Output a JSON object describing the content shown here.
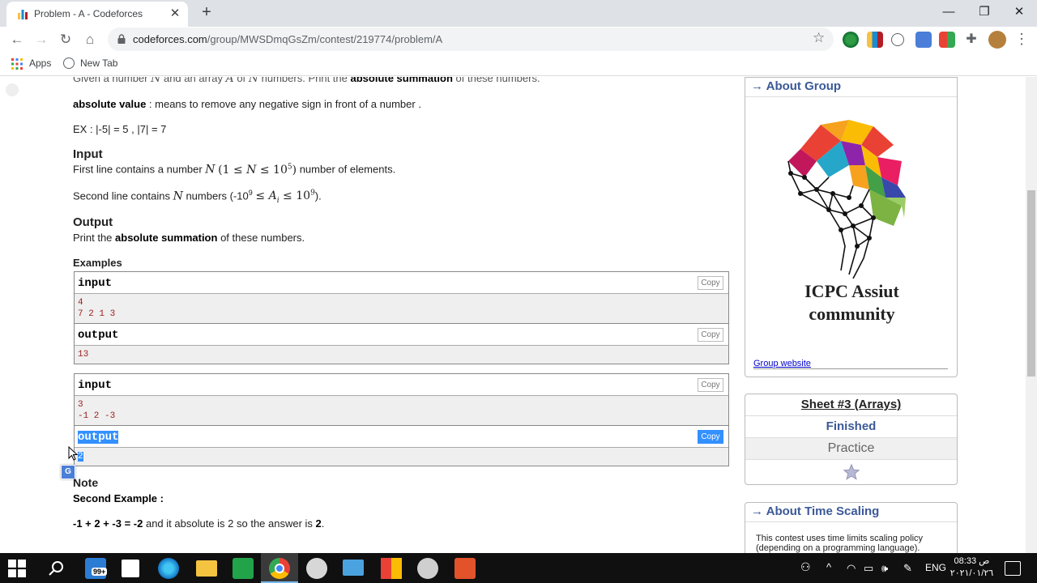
{
  "browser": {
    "tab_title": "Problem - A - Codeforces",
    "close_glyph": "✕",
    "newtab_glyph": "+",
    "url_host": "codeforces.com",
    "url_path": "/group/MWSDmqGsZm/contest/219774/problem/A",
    "bookmarks": {
      "apps": "Apps",
      "new_tab": "New Tab"
    }
  },
  "problem": {
    "intro_partial_a": "Given a number ",
    "intro_partial_b": " and an array ",
    "intro_partial_c": " of ",
    "intro_partial_d": " numbers. Print the ",
    "intro_partial_bold": "absolute summation",
    "intro_partial_e": " of these numbers.",
    "abs_bold": "absolute value",
    "abs_rest": " : means to remove any negative sign in front of a number .",
    "example_line": "EX : |-5| = 5 , |7| = 7",
    "input_title": "Input",
    "input_line1_a": "First line contains a number ",
    "input_line1_b": " number of elements.",
    "input_line2_a": "Second line contains ",
    "input_line2_b": " numbers (-10",
    "output_title": "Output",
    "output_a": "Print the ",
    "output_bold": "absolute summation",
    "output_b": " of these numbers.",
    "examples_title": "Examples",
    "note_title": "Note",
    "note_sub": "Second Example :",
    "note_line_bold": "-1 + 2 + -3 = -2",
    "note_line_mid": " and it absolute is 2 so the answer is ",
    "note_line_end": "2",
    "note_line_dot": "."
  },
  "examples": [
    {
      "input_label": "input",
      "input_lines": [
        "4",
        "7 2 1 3"
      ],
      "output_label": "output",
      "output_lines": [
        "13"
      ],
      "copy": "Copy"
    },
    {
      "input_label": "input",
      "input_lines": [
        "3",
        "-1 2 -3"
      ],
      "output_label": "output",
      "output_lines": [
        "2"
      ],
      "copy": "Copy"
    }
  ],
  "sidebar": {
    "about_group_title": "→ About Group",
    "logo_line1": "ICPC Assiut",
    "logo_line2": "community",
    "group_website": "Group website",
    "contest_name": "Sheet #3 (Arrays)",
    "contest_status": "Finished",
    "contest_mode": "Practice",
    "time_scaling_title": "→ About Time Scaling",
    "time_scaling_text_1": "This contest uses time limits scaling policy",
    "time_scaling_text_2": "(depending on a programming language)."
  },
  "taskbar": {
    "mail_badge": "99+",
    "lang": "ENG",
    "time": "08:33 ص",
    "date": "٢٠٢١/٠١/٢٦"
  },
  "colors": {
    "link_blue": "#3b5998",
    "sample_red": "#9b1c1c",
    "selection": "#3390ff"
  }
}
